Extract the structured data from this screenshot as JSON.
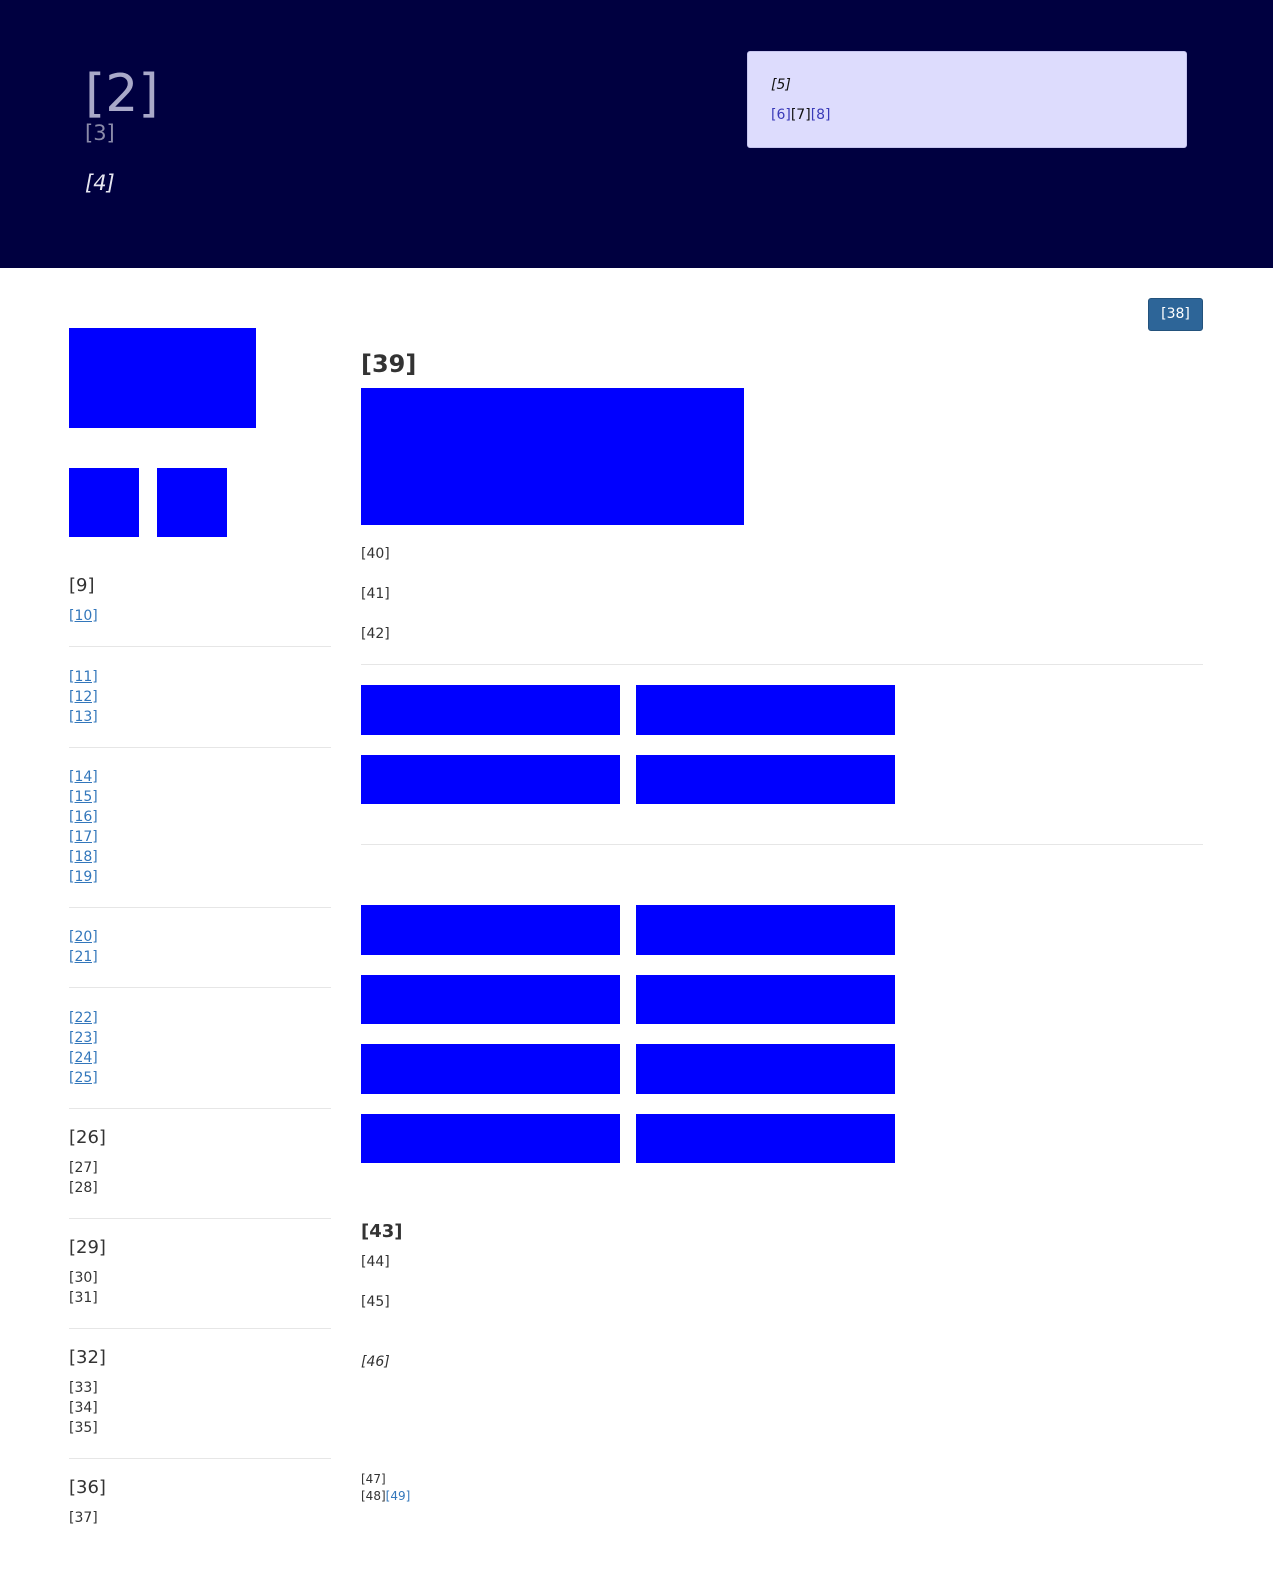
{
  "header": {
    "site_title": "[2]",
    "site_subtitle": "[3]",
    "tagline": "[4]",
    "notice": {
      "text": "[5]",
      "link_1": "[6]",
      "separator": "[7]",
      "link_2": "[8]"
    }
  },
  "sidebar": {
    "section_1": {
      "heading": "[9]",
      "links": [
        "[10]"
      ]
    },
    "section_2": {
      "links": [
        "[11]",
        "[12]",
        "[13]"
      ]
    },
    "section_3": {
      "links": [
        "[14]",
        "[15]",
        "[16]",
        "[17]",
        "[18]",
        "[19]"
      ]
    },
    "section_4": {
      "links": [
        "[20]",
        "[21]"
      ]
    },
    "section_5": {
      "links": [
        "[22]",
        "[23]",
        "[24]",
        "[25]"
      ]
    },
    "section_6": {
      "heading": "[26]",
      "items": [
        "[27]",
        "[28]"
      ]
    },
    "section_7": {
      "heading": "[29]",
      "items": [
        "[30]",
        "[31]"
      ]
    },
    "section_8": {
      "heading": "[32]",
      "items": [
        "[33]",
        "[34]",
        "[35]"
      ]
    },
    "section_9": {
      "heading": "[36]",
      "items": [
        "[37]"
      ]
    }
  },
  "toolbar": {
    "top_button_label": "[38]"
  },
  "main": {
    "heading": "[39]",
    "paragraphs": [
      "[40]",
      "[41]",
      "[42]"
    ],
    "section_2": {
      "heading": "[43]",
      "paragraphs": [
        "[44]",
        "[45]"
      ],
      "note": "[46]"
    }
  },
  "footer": {
    "line_1": "[47]",
    "line_2_text": "[48]",
    "line_2_link": "[49]"
  },
  "colors": {
    "header_background": "#000040",
    "placeholder_blue": "#0000ff",
    "link": "#3377bb",
    "button": "#2d6598",
    "notice_background": "#dddcfd"
  }
}
